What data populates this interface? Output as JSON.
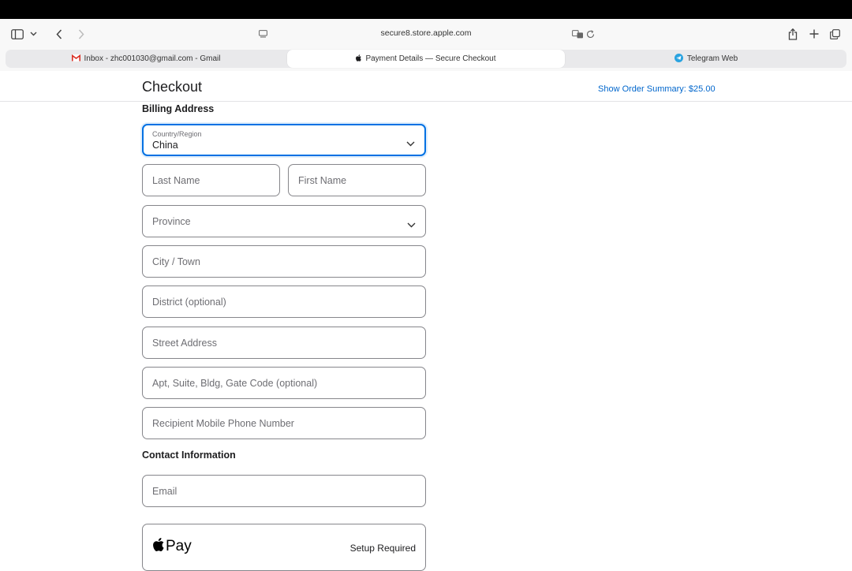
{
  "browser": {
    "url": "secure8.store.apple.com",
    "tabs": [
      {
        "label": "Inbox - zhc001030@gmail.com - Gmail",
        "icon": "gmail-icon"
      },
      {
        "label": "Payment Details — Secure Checkout",
        "icon": "apple-logo-icon",
        "active": true
      },
      {
        "label": "Telegram Web",
        "icon": "telegram-icon"
      }
    ]
  },
  "header": {
    "title": "Checkout",
    "summary_link": "Show Order Summary: $25.00"
  },
  "billing": {
    "section_title": "Billing Address",
    "country_label": "Country/Region",
    "country_value": "China",
    "last_name_placeholder": "Last Name",
    "first_name_placeholder": "First Name",
    "province_placeholder": "Province",
    "city_placeholder": "City / Town",
    "district_placeholder": "District (optional)",
    "street_placeholder": "Street Address",
    "apt_placeholder": "Apt, Suite, Bldg, Gate Code (optional)",
    "phone_placeholder": "Recipient Mobile Phone Number"
  },
  "contact": {
    "section_title": "Contact Information",
    "email_placeholder": "Email"
  },
  "payment": {
    "applepay_label": "Pay",
    "applepay_status": "Setup Required"
  },
  "colors": {
    "accent": "#0071e3",
    "link": "#0066cc",
    "border": "#86868b"
  }
}
